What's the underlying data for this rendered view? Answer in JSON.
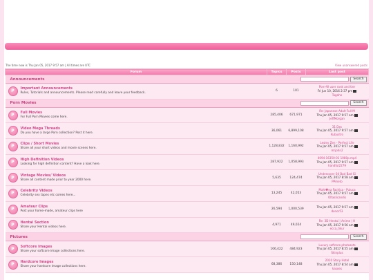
{
  "time_text": "The time now is Thu Jan 05, 2017 9:57 am | All times are UTC",
  "view_unanswered": "View unanswered posts",
  "headers": {
    "forum": "Forum",
    "topics": "Topics",
    "posts": "Posts",
    "last_post": "Last post"
  },
  "search_label": "Search",
  "categories": [
    {
      "name": "Announcements",
      "forums": [
        {
          "title": "Important Announcements",
          "desc": "Rules, Tutorials and announcements. Please read carefully and leave your feedback.",
          "topics": "6",
          "posts": "101",
          "last_title": "Porn-W user rank and tier",
          "last_date": "Fri Jun 10, 2016 2:37 pm",
          "last_by": "Tagahe"
        }
      ]
    },
    {
      "name": "Porn Movies",
      "forums": [
        {
          "title": "Full Movies",
          "desc": "For Full Porn Movies come here.",
          "topics": "285,406",
          "posts": "671,971",
          "last_title": "Re: Japanese Adult Full M",
          "last_date": "Thu Jan 05, 2017 9:57 am",
          "last_by": "JeffMorgan"
        },
        {
          "title": "Video Mega Threads",
          "desc": "Do you have a large Porn collection? Post it here.",
          "topics": "36,061",
          "posts": "6,899,108",
          "last_title": "31 Dec",
          "last_date": "Thu Jan 05, 2017 9:57 am",
          "last_by": "Kubustro"
        },
        {
          "title": "Clips / Short Movies",
          "desc": "Share all your short videos and movie scenes here.",
          "topics": "1,128,832",
          "posts": "1,160,992",
          "last_title": "Lesley Zen - Perfect Life",
          "last_date": "Thu Jan 05, 2017 9:57 am",
          "last_by": "mrjohn2"
        },
        {
          "title": "High Definition Videos",
          "desc": "Looking for high definition content? Have a look here.",
          "topics": "287,922",
          "posts": "1,058,993",
          "last_title": "4094-16350-01 1080p.mp4",
          "last_date": "Thu Jan 05, 2017 9:57 am",
          "last_by": "handful2279"
        },
        {
          "title": "Vintage Movies/ Videos",
          "desc": "Share all content made prior to year 2000 here.",
          "topics": "5,635",
          "posts": "124,474",
          "last_title": "Undercover 04 Bad Bad Gi",
          "last_date": "Thu Jan 05, 2017 8:58 am",
          "last_by": "PPmeto"
        },
        {
          "title": "Celebrity Videos",
          "desc": "Celebrity sex tapes etc comes here...",
          "topics": "13,245",
          "posts": "42,053",
          "last_title": "Mahi�na Fachica - Puluca",
          "last_date": "Thu Jan 05, 2017 9:57 am",
          "last_by": "Oltaslicandis"
        },
        {
          "title": "Amateur Clips",
          "desc": "Post your home-made, amateur clips here",
          "topics": "26,594",
          "posts": "1,000,539",
          "last_title": "",
          "last_date": "Thu Jan 05, 2017 9:57 am",
          "last_by": "donor53"
        },
        {
          "title": "Hentai Section",
          "desc": "Share your Hentai videos here.",
          "topics": "4,971",
          "posts": "49,024",
          "last_title": "Re: 3D Hentai | Anime | H",
          "last_date": "Thu Jan 05, 2017 9:56 am",
          "last_by": "ecca_tikur"
        }
      ]
    },
    {
      "name": "Pictures",
      "forums": [
        {
          "title": "Softcore Images",
          "desc": "Share your softcore image collections here.",
          "topics": "106,422",
          "posts": "484,923",
          "last_title": "Luxury softcore photosets",
          "last_date": "Thu Jan 05, 2017 8:55 am",
          "last_by": "Skinplus"
        },
        {
          "title": "Hardcore Images",
          "desc": "Share your hardcore image collections here.",
          "topics": "68,386",
          "posts": "150,148",
          "last_title": "2010 Story Hotel",
          "last_date": "Thu Jan 05, 2017 8:54 am",
          "last_by": "kasoes"
        }
      ]
    }
  ]
}
